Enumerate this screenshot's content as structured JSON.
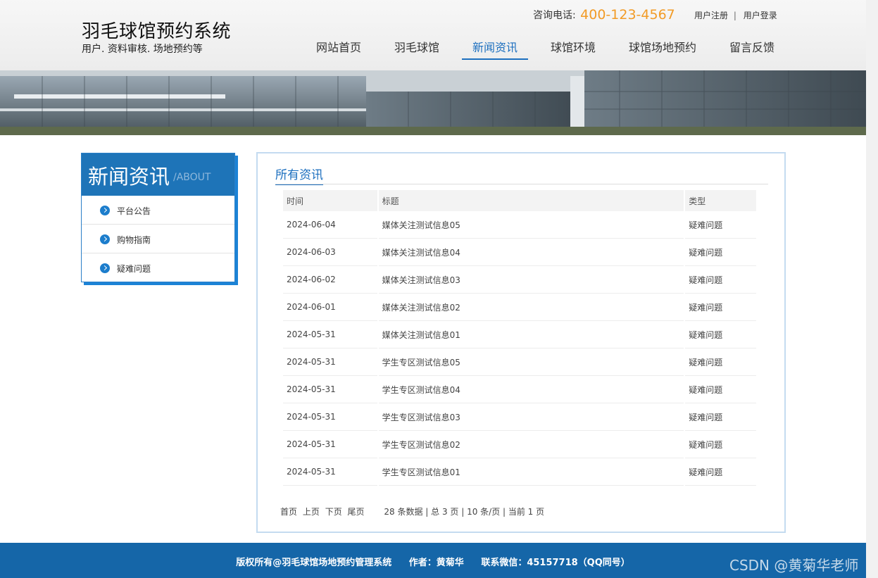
{
  "header": {
    "site_title": "羽毛球馆预约系统",
    "site_subtitle": "用户. 资料审核. 场地预约等",
    "hotline_label": "咨询电话:",
    "hotline_number": "400-123-4567",
    "register": "用户注册",
    "login": "用户登录",
    "separator": "|",
    "nav": [
      {
        "label": "网站首页"
      },
      {
        "label": "羽毛球馆"
      },
      {
        "label": "新闻资讯",
        "active": true
      },
      {
        "label": "球馆环境"
      },
      {
        "label": "球馆场地预约"
      },
      {
        "label": "留言反馈"
      }
    ]
  },
  "sidebar": {
    "title": "新闻资讯",
    "subtitle": "/ABOUT",
    "items": [
      {
        "label": "平台公告"
      },
      {
        "label": "购物指南"
      },
      {
        "label": "疑难问题"
      }
    ]
  },
  "main": {
    "title": "所有资讯",
    "columns": [
      "时间",
      "标题",
      "类型"
    ],
    "rows": [
      {
        "date": "2024-06-04",
        "title": "媒体关注测试信息05",
        "type": "疑难问题"
      },
      {
        "date": "2024-06-03",
        "title": "媒体关注测试信息04",
        "type": "疑难问题"
      },
      {
        "date": "2024-06-02",
        "title": "媒体关注测试信息03",
        "type": "疑难问题"
      },
      {
        "date": "2024-06-01",
        "title": "媒体关注测试信息02",
        "type": "疑难问题"
      },
      {
        "date": "2024-05-31",
        "title": "媒体关注测试信息01",
        "type": "疑难问题"
      },
      {
        "date": "2024-05-31",
        "title": "学生专区测试信息05",
        "type": "疑难问题"
      },
      {
        "date": "2024-05-31",
        "title": "学生专区测试信息04",
        "type": "疑难问题"
      },
      {
        "date": "2024-05-31",
        "title": "学生专区测试信息03",
        "type": "疑难问题"
      },
      {
        "date": "2024-05-31",
        "title": "学生专区测试信息02",
        "type": "疑难问题"
      },
      {
        "date": "2024-05-31",
        "title": "学生专区测试信息01",
        "type": "疑难问题"
      }
    ],
    "pager": {
      "first": "首页",
      "prev": "上页",
      "next": "下页",
      "last": "尾页",
      "info": "28 条数据 | 总 3 页 | 10 条/页 | 当前 1 页"
    }
  },
  "footer": {
    "copyright": "版权所有@羽毛球馆场地预约管理系统",
    "author": "作者：黄菊华",
    "contact": "联系微信：45157718（QQ同号）"
  },
  "watermark": "CSDN @黄菊华老师",
  "colors": {
    "accent": "#1c6fbf",
    "sidebar_head": "#1e74b8",
    "hotline": "#f29b26",
    "footer": "#1566a8"
  }
}
